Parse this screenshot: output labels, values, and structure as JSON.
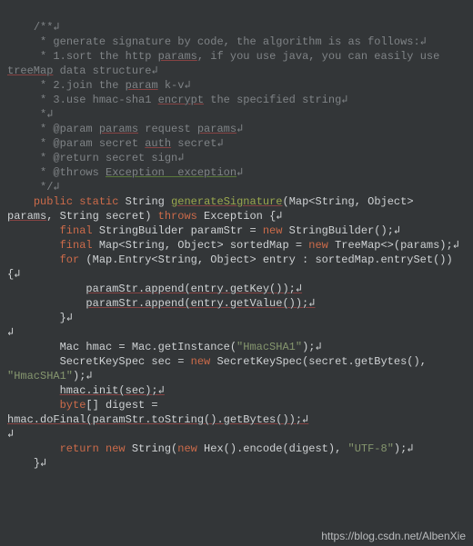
{
  "doc": {
    "c01": "/**↲",
    "c02": " * generate signature by code, the algorithm is as follows:↲",
    "c03a": " * 1.sort the http ",
    "c03b": "params",
    "c03c": ", if you use java, you can easily use ",
    "c03d": "treeMap",
    "c03e": " data structure↲",
    "c04a": " * 2.join the ",
    "c04b": "param",
    "c04c": " k-v↲",
    "c05a": " * 3.use hmac-sha1 ",
    "c05b": "encrypt",
    "c05c": " the specified string↲",
    "c06": " *↲",
    "c07a": " * @param ",
    "c07b": "params",
    "c07c": " request ",
    "c07d": "params",
    "c07e": "↲",
    "c08a": " * @param secret ",
    "c08b": "auth",
    "c08c": " secret↲",
    "c09": " * @return secret sign↲",
    "c10a": " * @throws ",
    "c10b": "Exception  exception",
    "c10c": "↲",
    "c11": " */↲",
    "k_public": "public",
    "k_static": "static",
    "t_string": "String",
    "fn_name": "generateSignature",
    "sig_open": "(Map<String, Object> ",
    "sig_params": "params",
    "sig_mid": ", String secret) ",
    "k_throws": "throws",
    "sig_close": " Exception {↲",
    "k_final1": "final",
    "l1a": " StringBuilder paramStr = ",
    "k_new": "new",
    "l1b": " StringBuilder();↲",
    "k_final2": "final",
    "l2a": " Map<String, Object> sortedMap = ",
    "l2b": " TreeMap<>(params);↲",
    "k_for": "for",
    "l3a": " (Map.Entry<String, Object> entry : sortedMap.entrySet()) {↲",
    "l4": "paramStr.append(entry.getKey());↲",
    "l5": "paramStr.append(entry.getValue());↲",
    "l6": "}↲",
    "blank": "↲",
    "l7a": "Mac hmac = Mac.getInstance(",
    "s_hmac1": "\"HmacSHA1\"",
    "l7b": ");↲",
    "l8a": "SecretKeySpec sec = ",
    "l8b": " SecretKeySpec(secret.getBytes(), ",
    "s_hmac2": "\"HmacSHA1\"",
    "l8c": ");↲",
    "l9": "hmac.init(sec);↲",
    "k_byte": "byte",
    "l10a": "[] digest = ",
    "l10b": "hmac.doFinal(paramStr.toString().getBytes());↲",
    "k_return": "return",
    "l11a": " String(",
    "l11b": " Hex().encode(digest), ",
    "s_utf8": "\"UTF-8\"",
    "l11c": ");↲",
    "l12": "}↲"
  },
  "watermark": "https://blog.csdn.net/AlbenXie"
}
